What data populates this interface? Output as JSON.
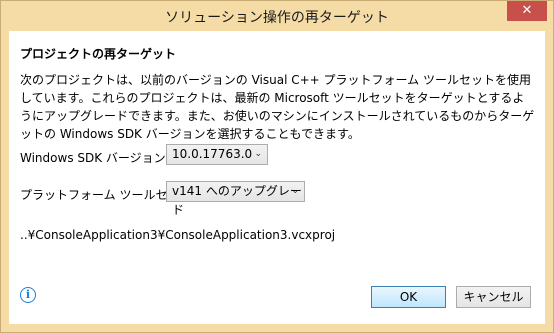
{
  "window": {
    "title": "ソリューション操作の再ターゲット",
    "close_label": "✕"
  },
  "dialog": {
    "heading": "プロジェクトの再ターゲット",
    "description": "次のプロジェクトは、以前のバージョンの Visual C++ プラットフォーム ツールセットを使用しています。これらのプロジェクトは、最新の Microsoft ツールセットをターゲットとするようにアップグレードできます。また、お使いのマシンにインストールされているものからターゲットの Windows SDK バージョンを選択することもできます。",
    "sdk_label": "Windows SDK バージョン:",
    "sdk_value": "10.0.17763.0",
    "toolset_label": "プラットフォーム ツールセット:",
    "toolset_value": "v141 へのアップグレード",
    "project_path": "..¥ConsoleApplication3¥ConsoleApplication3.vcxproj"
  },
  "footer": {
    "info_icon": "i",
    "ok_label": "OK",
    "cancel_label": "キャンセル"
  },
  "icons": {
    "chevron": "⌄"
  }
}
